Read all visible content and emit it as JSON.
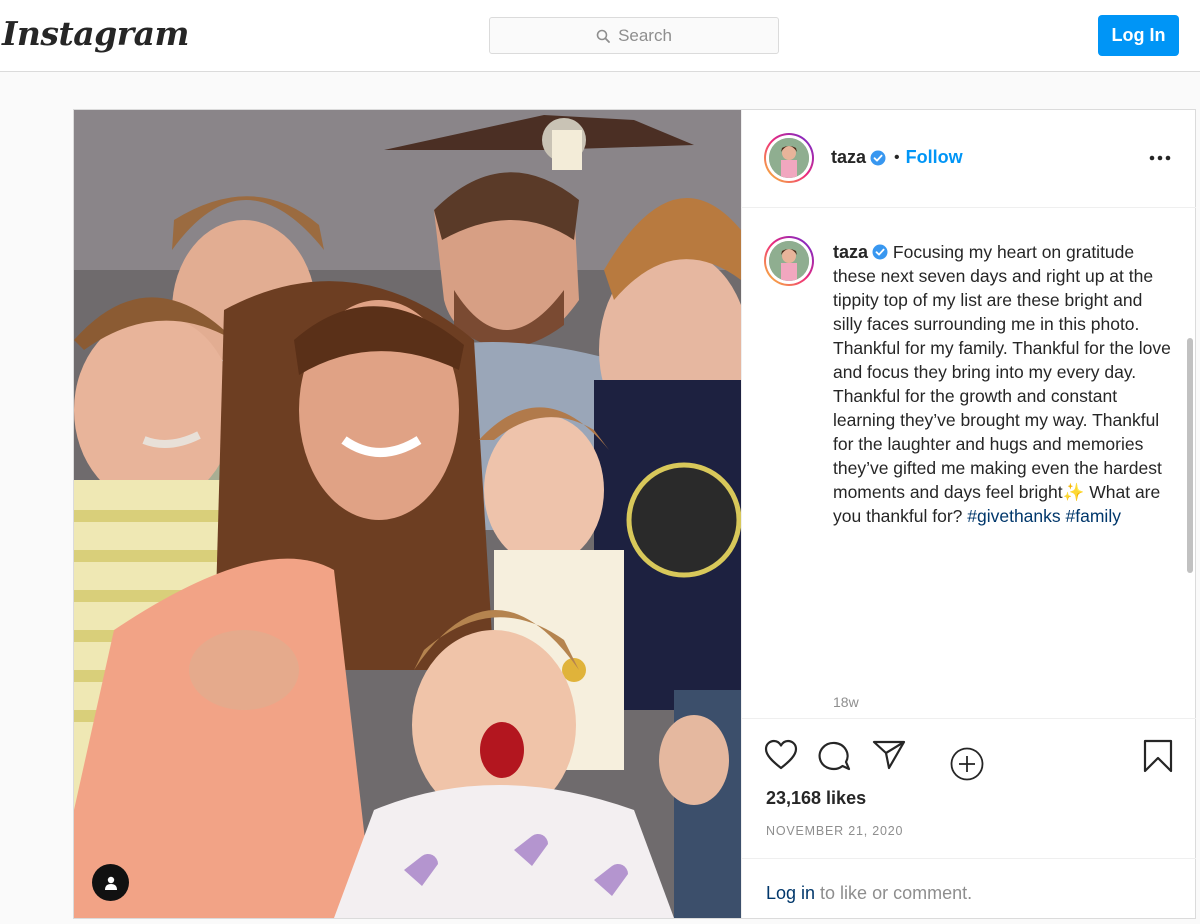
{
  "header": {
    "logo_text": "Instagram",
    "search_placeholder": "Search",
    "login_label": "Log In",
    "accent_color": "#0095f6"
  },
  "post": {
    "username": "taza",
    "verified": true,
    "separator": "•",
    "follow_label": "Follow",
    "more_icon": "more-options-icon",
    "caption_parts": {
      "body": "Focusing my heart on gratitude these next seven days and right up at the tippity top of my list are these bright and silly faces surrounding me in this photo. Thankful for my family. Thankful for the love and focus they bring into my every day. Thankful for the growth and constant learning they’ve brought my way. Thankful for the laughter and hugs and memories they’ve gifted me making even the hardest moments and days feel bright",
      "emoji": "✨",
      "tail": " What are you thankful for? ",
      "hashtag1": "#givethanks",
      "space": " ",
      "hashtag2": "#family"
    },
    "time_ago": "18w",
    "likes": "23,168 likes",
    "date": "NOVEMBER 21, 2020",
    "footer": {
      "login_link": "Log in",
      "rest": " to like or comment."
    },
    "icons": [
      "heart-icon",
      "comment-icon",
      "share-icon",
      "bookmark-icon",
      "add-circle-icon",
      "user-tag-icon"
    ]
  }
}
